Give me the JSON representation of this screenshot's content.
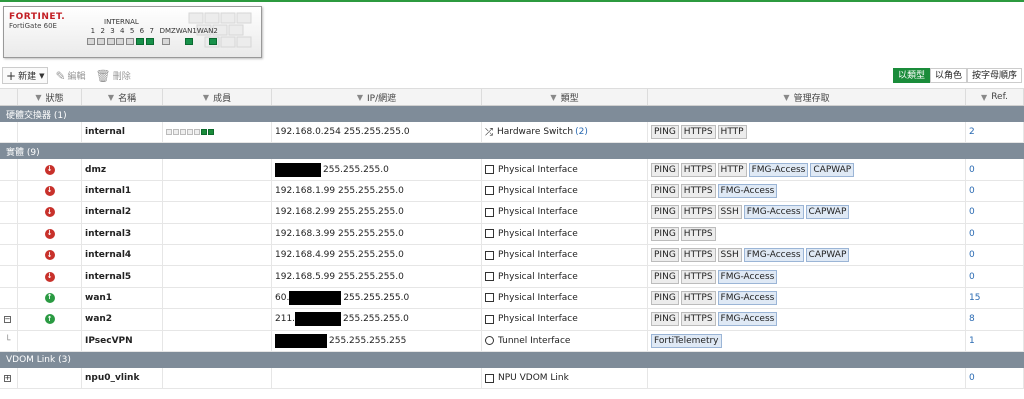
{
  "device": {
    "logo": "FORTINET.",
    "model": "FortiGate 60E",
    "group_label": "INTERNAL",
    "port_labels": [
      "1",
      "2",
      "3",
      "4",
      "5",
      "6",
      "7"
    ],
    "wan_labels": [
      "DMZ",
      "WAN1",
      "WAN2"
    ],
    "port_status": [
      "down",
      "down",
      "down",
      "down",
      "down",
      "up",
      "up"
    ],
    "wan_status": [
      "down",
      "up",
      "up"
    ]
  },
  "toolbar": {
    "new_label": "新建",
    "edit_label": "編輯",
    "delete_label": "刪除"
  },
  "view_tabs": [
    {
      "label": "以類型",
      "active": true
    },
    {
      "label": "以角色",
      "active": false
    },
    {
      "label": "按字母順序",
      "active": false
    }
  ],
  "columns": {
    "status": "狀態",
    "name": "名稱",
    "members": "成員",
    "ip": "IP/網遮",
    "type": "類型",
    "access": "管理存取",
    "ref": "Ref."
  },
  "sections": [
    {
      "title": "硬體交換器 (1)",
      "rows": [
        {
          "status": "",
          "name": "internal",
          "members": "1234567",
          "ip": "192.168.0.254 255.255.255.0",
          "ip_redacted": false,
          "type": "Hardware Switch",
          "type_count": "(2)",
          "type_icon": "switch",
          "access": [
            "PING",
            "HTTPS",
            "HTTP"
          ],
          "access_blue": [],
          "ref": "2"
        }
      ]
    },
    {
      "title": "實體 (9)",
      "rows": [
        {
          "status": "down",
          "name": "dmz",
          "ip_prefix": "",
          "ip_suffix": "255.255.255.0",
          "ip_redacted": true,
          "redact_w": 46,
          "type": "Physical Interface",
          "type_icon": "phys",
          "access": [
            "PING",
            "HTTPS",
            "HTTP",
            "FMG-Access",
            "CAPWAP"
          ],
          "access_blue": [
            "FMG-Access",
            "CAPWAP"
          ],
          "ref": "0"
        },
        {
          "status": "down",
          "name": "internal1",
          "ip": "192.168.1.99 255.255.255.0",
          "ip_redacted": false,
          "type": "Physical Interface",
          "type_icon": "phys",
          "access": [
            "PING",
            "HTTPS",
            "FMG-Access"
          ],
          "access_blue": [
            "FMG-Access"
          ],
          "ref": "0"
        },
        {
          "status": "down",
          "name": "internal2",
          "ip": "192.168.2.99 255.255.255.0",
          "ip_redacted": false,
          "type": "Physical Interface",
          "type_icon": "phys",
          "access": [
            "PING",
            "HTTPS",
            "SSH",
            "FMG-Access",
            "CAPWAP"
          ],
          "access_blue": [
            "FMG-Access",
            "CAPWAP"
          ],
          "ref": "0"
        },
        {
          "status": "down",
          "name": "internal3",
          "ip": "192.168.3.99 255.255.255.0",
          "ip_redacted": false,
          "type": "Physical Interface",
          "type_icon": "phys",
          "access": [
            "PING",
            "HTTPS"
          ],
          "access_blue": [],
          "ref": "0"
        },
        {
          "status": "down",
          "name": "internal4",
          "ip": "192.168.4.99 255.255.255.0",
          "ip_redacted": false,
          "type": "Physical Interface",
          "type_icon": "phys",
          "access": [
            "PING",
            "HTTPS",
            "SSH",
            "FMG-Access",
            "CAPWAP"
          ],
          "access_blue": [
            "FMG-Access",
            "CAPWAP"
          ],
          "ref": "0"
        },
        {
          "status": "down",
          "name": "internal5",
          "ip": "192.168.5.99 255.255.255.0",
          "ip_redacted": false,
          "type": "Physical Interface",
          "type_icon": "phys",
          "access": [
            "PING",
            "HTTPS",
            "FMG-Access"
          ],
          "access_blue": [
            "FMG-Access"
          ],
          "ref": "0"
        },
        {
          "status": "up",
          "name": "wan1",
          "ip_prefix": "60.",
          "ip_suffix": "255.255.255.0",
          "ip_redacted": true,
          "redact_w": 52,
          "type": "Physical Interface",
          "type_icon": "phys",
          "access": [
            "PING",
            "HTTPS",
            "FMG-Access"
          ],
          "access_blue": [
            "FMG-Access"
          ],
          "ref": "15"
        },
        {
          "status": "up",
          "name": "wan2",
          "ip_prefix": "211.",
          "ip_suffix": "255.255.255.0",
          "ip_redacted": true,
          "redact_w": 46,
          "expand": "−",
          "type": "Physical Interface",
          "type_icon": "phys",
          "access": [
            "PING",
            "HTTPS",
            "FMG-Access"
          ],
          "access_blue": [
            "FMG-Access"
          ],
          "ref": "8"
        },
        {
          "status": "",
          "name": "IPsecVPN",
          "ip_prefix": "",
          "ip_suffix": "255.255.255.255",
          "ip_redacted": true,
          "redact_w": 52,
          "child": true,
          "type": "Tunnel Interface",
          "type_icon": "tunnel",
          "access": [
            "FortiTelemetry"
          ],
          "access_blue": [
            "FortiTelemetry"
          ],
          "ref": "1"
        }
      ]
    },
    {
      "title": "VDOM Link (3)",
      "rows": [
        {
          "status": "",
          "name": "npu0_vlink",
          "ip": "",
          "ip_redacted": false,
          "expand": "+",
          "type": "NPU VDOM Link",
          "type_icon": "npu",
          "access": [],
          "access_blue": [],
          "ref": "0"
        }
      ]
    }
  ],
  "colors": {
    "accent": "#1a8c3a",
    "section_bg": "#7f8c99",
    "status_down": "#c8312b",
    "status_up": "#2a9a42",
    "brand_red": "#c31e24"
  }
}
